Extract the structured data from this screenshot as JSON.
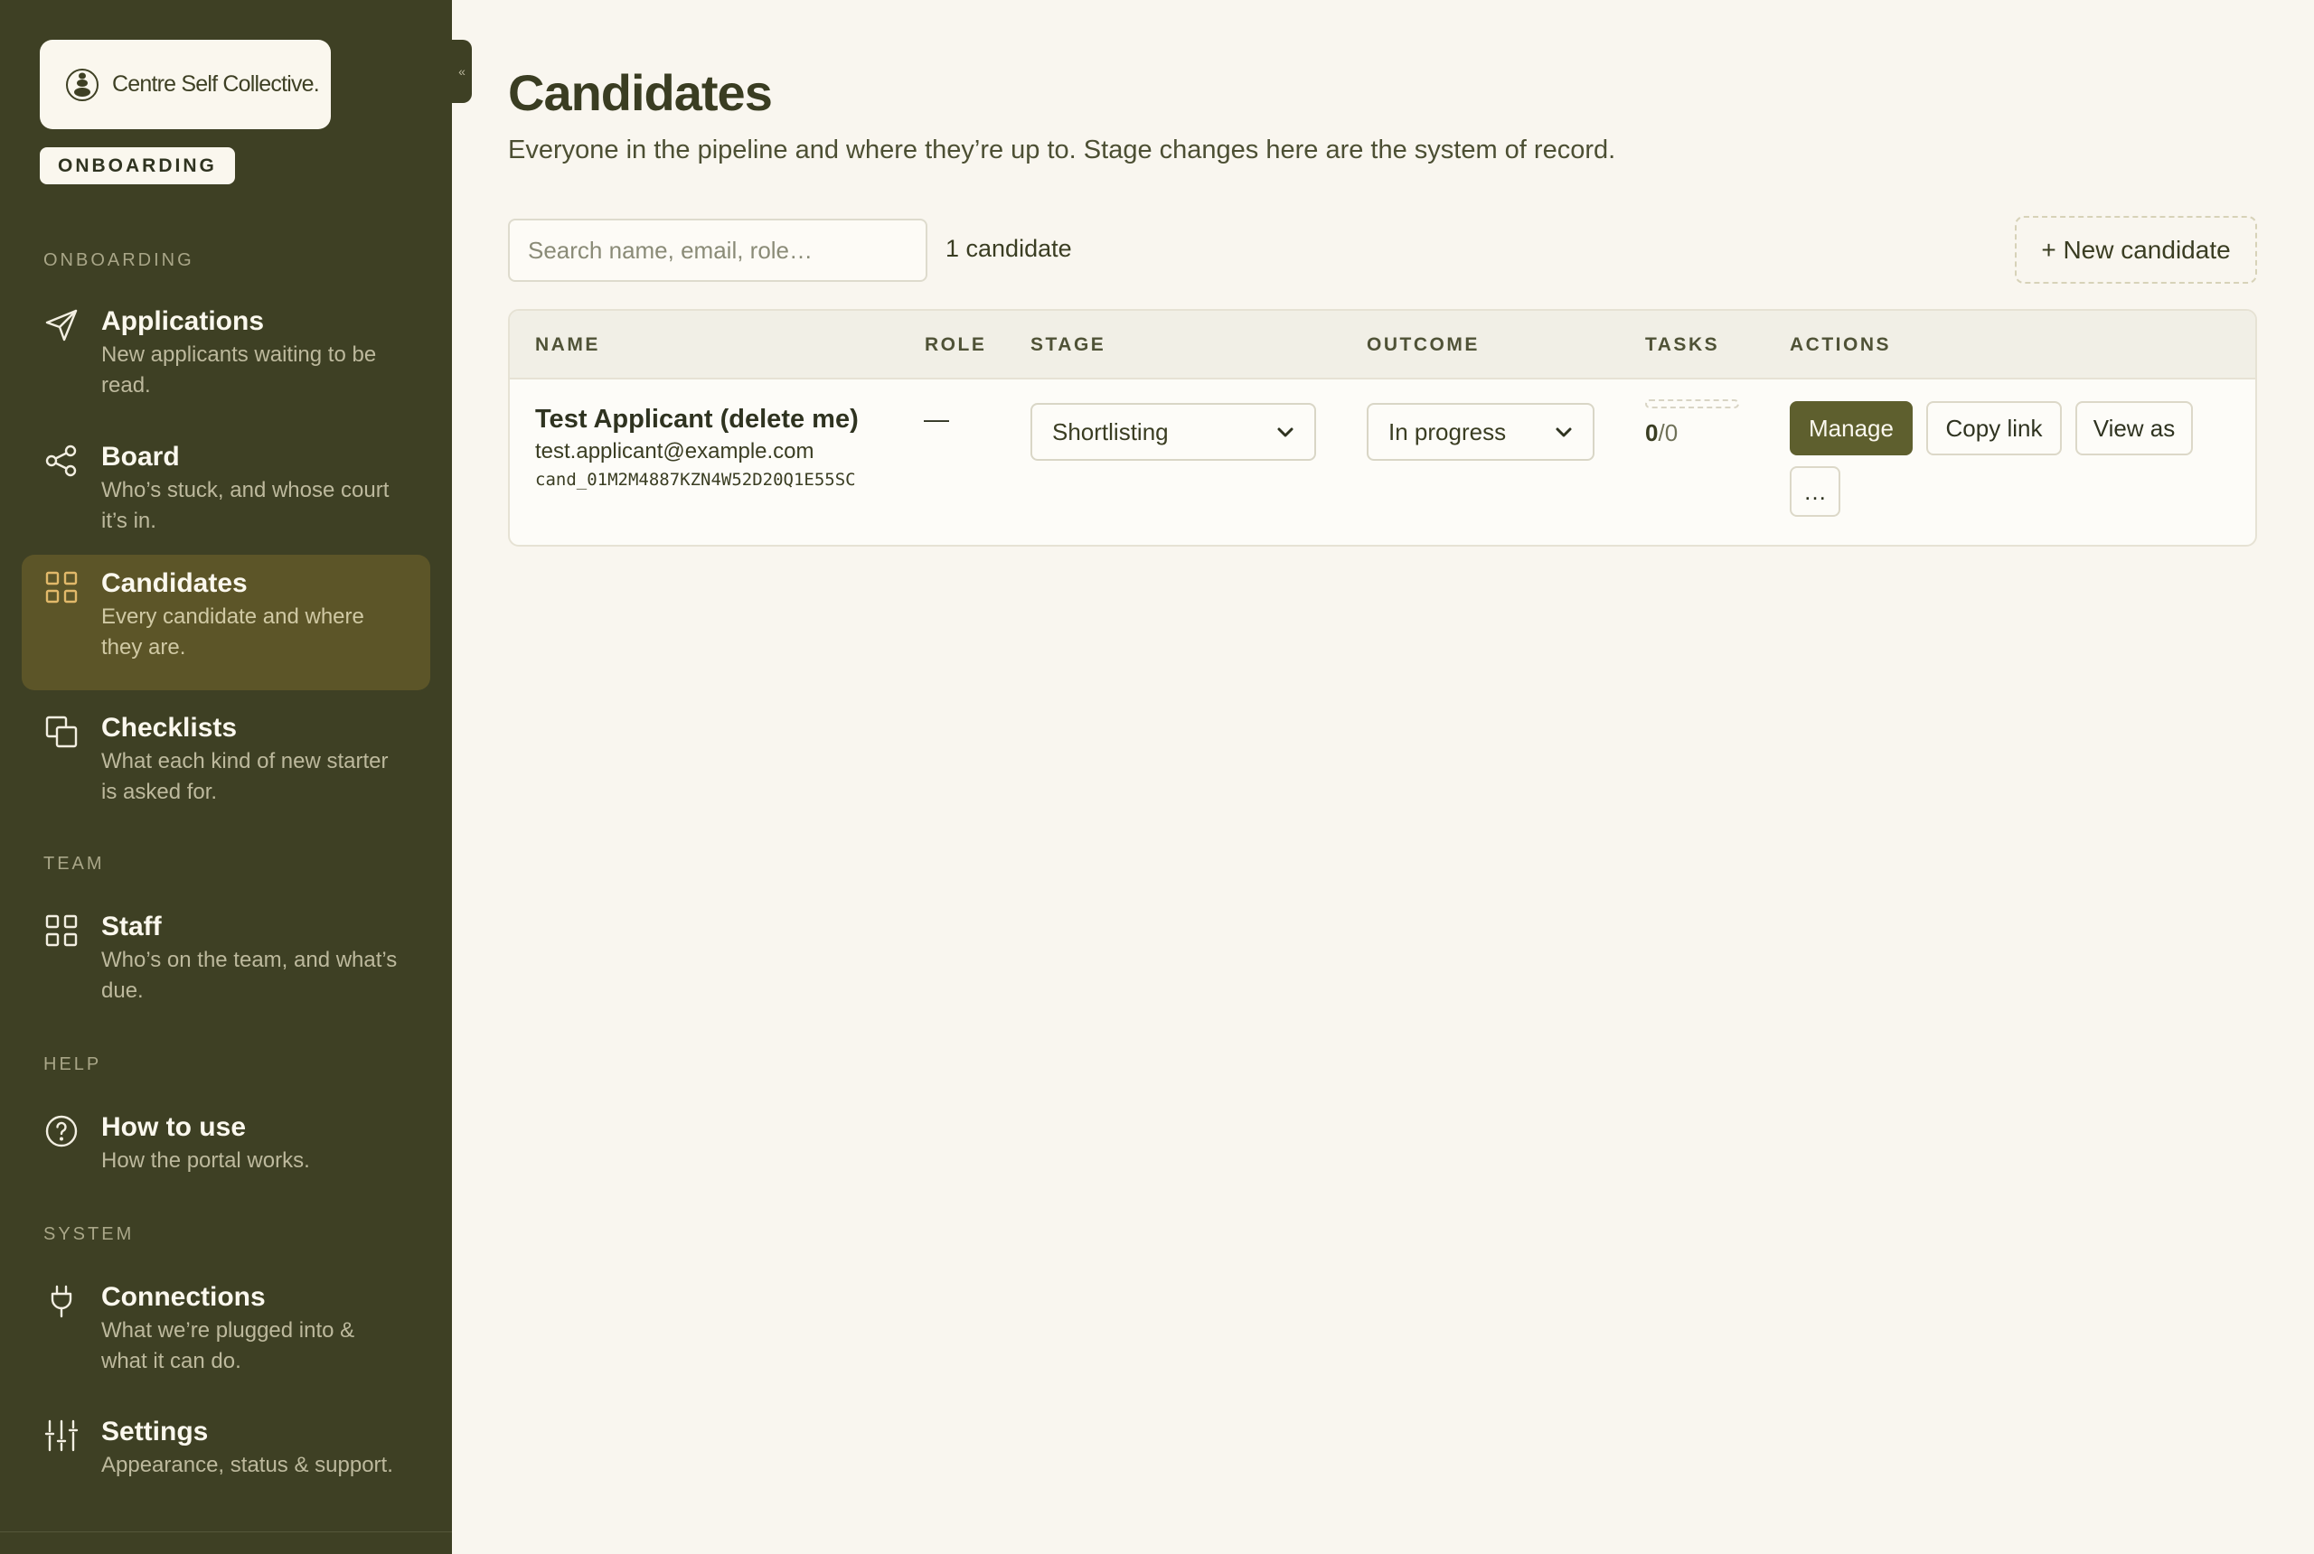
{
  "brand": {
    "name": "Centre Self Collective.",
    "environment": "ONBOARDING"
  },
  "sidebar": {
    "sections": [
      {
        "label": "ONBOARDING",
        "items": [
          {
            "title": "Applications",
            "desc_l1": "New applicants waiting to be",
            "desc_l2": "read.",
            "icon": "send-icon"
          },
          {
            "title": "Board",
            "desc_l1": "Who’s stuck, and whose court",
            "desc_l2": "it’s in.",
            "icon": "share-icon"
          },
          {
            "title": "Candidates",
            "desc_l1": "Every candidate and where",
            "desc_l2": "they are.",
            "icon": "grid-icon",
            "active": true
          },
          {
            "title": "Checklists",
            "desc_l1": "What each kind of new starter",
            "desc_l2": "is asked for.",
            "icon": "copy-icon"
          }
        ]
      },
      {
        "label": "TEAM",
        "items": [
          {
            "title": "Staff",
            "desc_l1": "Who’s on the team, and what’s",
            "desc_l2": "due.",
            "icon": "grid-icon"
          }
        ]
      },
      {
        "label": "HELP",
        "items": [
          {
            "title": "How to use",
            "desc_l1": "How the portal works.",
            "icon": "help-circle-icon"
          }
        ]
      },
      {
        "label": "SYSTEM",
        "items": [
          {
            "title": "Connections",
            "desc_l1": "What we’re plugged into &",
            "desc_l2": "what it can do.",
            "icon": "plug-icon"
          },
          {
            "title": "Settings",
            "desc_l1": "Appearance, status & support.",
            "icon": "sliders-icon"
          }
        ]
      }
    ],
    "collapse_glyph": "«"
  },
  "page": {
    "title": "Candidates",
    "subtitle": "Everyone in the pipeline and where they’re up to. Stage changes here are the system of record.",
    "search_placeholder": "Search name, email, role…",
    "count": "1 candidate",
    "new_button": "+ New candidate"
  },
  "table": {
    "columns": [
      "NAME",
      "ROLE",
      "STAGE",
      "OUTCOME",
      "TASKS",
      "ACTIONS"
    ],
    "rows": [
      {
        "name": "Test Applicant (delete me)",
        "email": "test.applicant@example.com",
        "id": "cand_01M2M4887KZN4W52D20Q1E55SC",
        "role": "—",
        "stage": "Shortlisting",
        "outcome": "In progress",
        "tasks_done": "0",
        "tasks_total": "/0",
        "actions": {
          "manage": "Manage",
          "copy_link": "Copy link",
          "view_as": "View as",
          "more": "…"
        }
      }
    ]
  },
  "colors": {
    "sidebar_bg": "#3e4024",
    "active_bg": "#5c5528",
    "accent_icon": "#e2b96a",
    "primary_button": "#5e5f2e",
    "page_bg": "#f9f6ef"
  }
}
